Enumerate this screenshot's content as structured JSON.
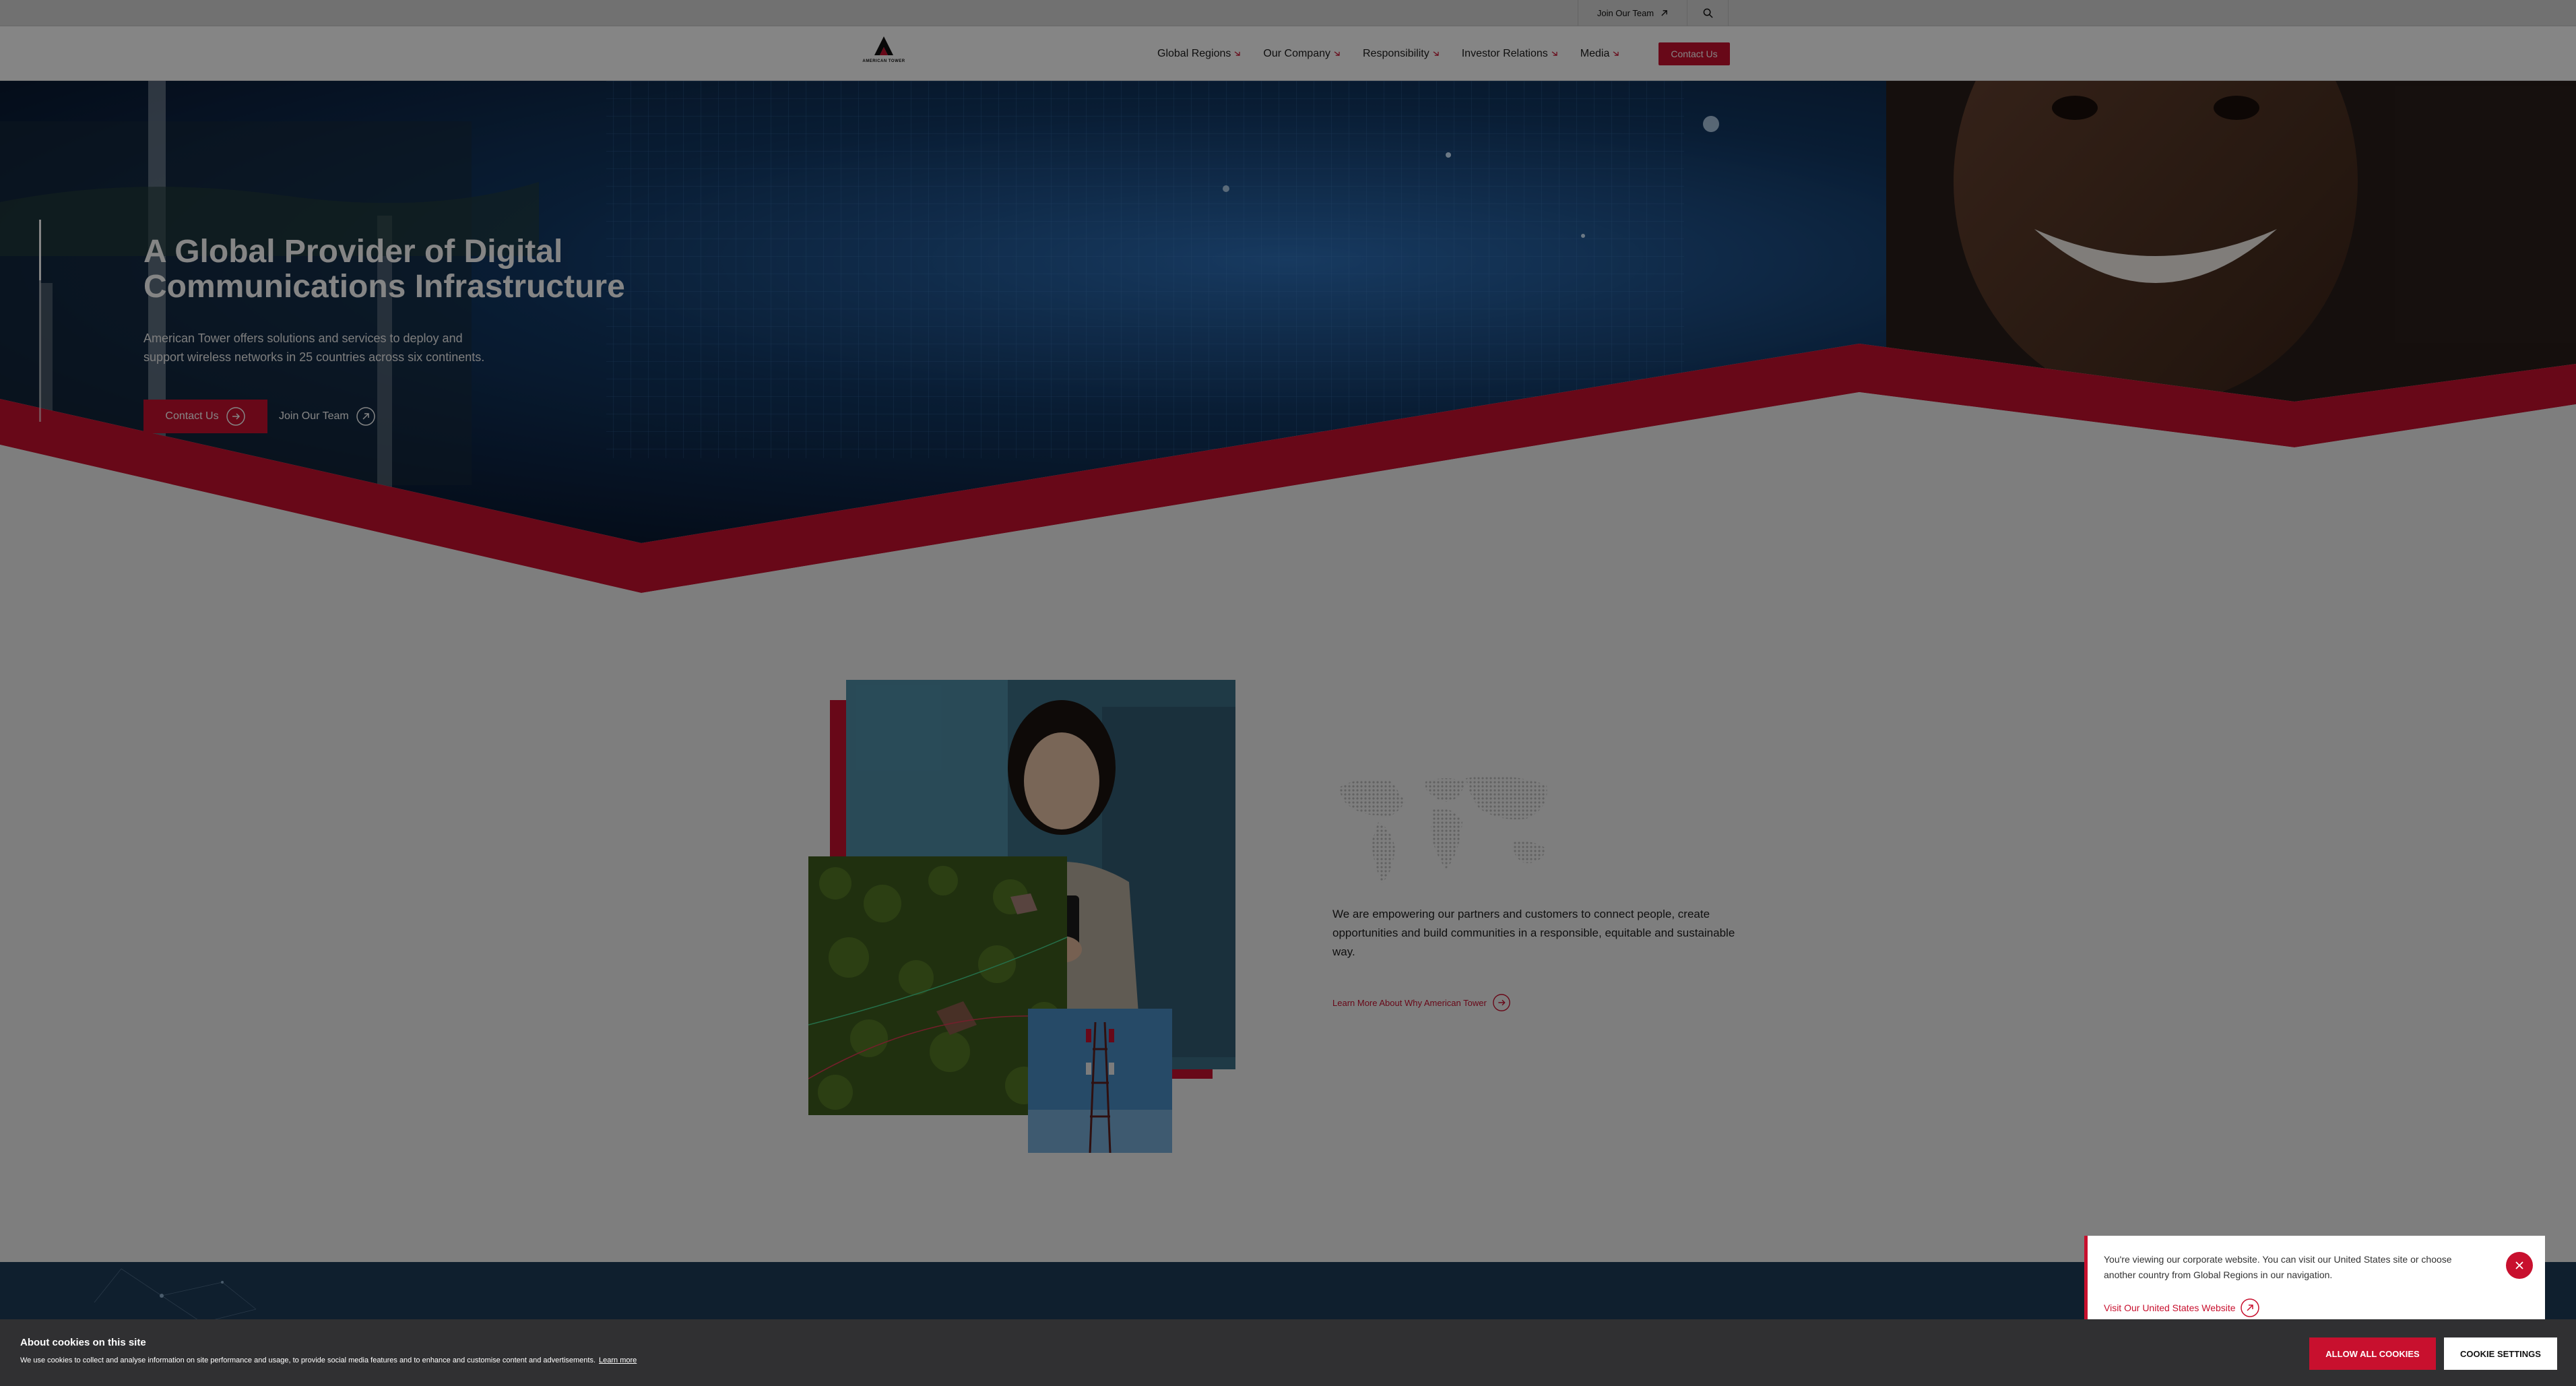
{
  "utility_bar": {
    "join_label": "Join Our Team",
    "join_icon": "external-arrow-icon",
    "search_icon": "search-icon"
  },
  "header": {
    "logo_text": "AMERICAN TOWER",
    "nav": [
      {
        "label": "Global Regions"
      },
      {
        "label": "Our Company"
      },
      {
        "label": "Responsibility"
      },
      {
        "label": "Investor Relations"
      },
      {
        "label": "Media"
      }
    ],
    "contact_label": "Contact Us"
  },
  "hero": {
    "title": "A Global Provider of Digital Communications Infrastructure",
    "description": "American Tower offers solutions and services to deploy and support wireless networks in 25 countries across six continents.",
    "primary_button": "Contact Us",
    "secondary_button": "Join Our Team"
  },
  "intro": {
    "text": "We are empowering our partners and customers to connect people, create opportunities and build communities in a responsible, equitable and sustainable way.",
    "link": "Learn More About Why American Tower"
  },
  "region_notice": {
    "text": "You're viewing our corporate website. You can visit our United States site or choose another country from Global Regions in our navigation.",
    "link": "Visit Our United States Website"
  },
  "cookie_bar": {
    "title": "About cookies on this site",
    "description": "We use cookies to collect and analyse information on site performance and usage, to provide social media features and to enhance and customise content and advertisements.",
    "learn_more": "Learn more",
    "allow_label": "ALLOW ALL COOKIES",
    "settings_label": "COOKIE SETTINGS"
  },
  "colors": {
    "brand_red": "#c8102e",
    "dark_navy": "#1e3c58",
    "cookie_bg": "#303032"
  }
}
